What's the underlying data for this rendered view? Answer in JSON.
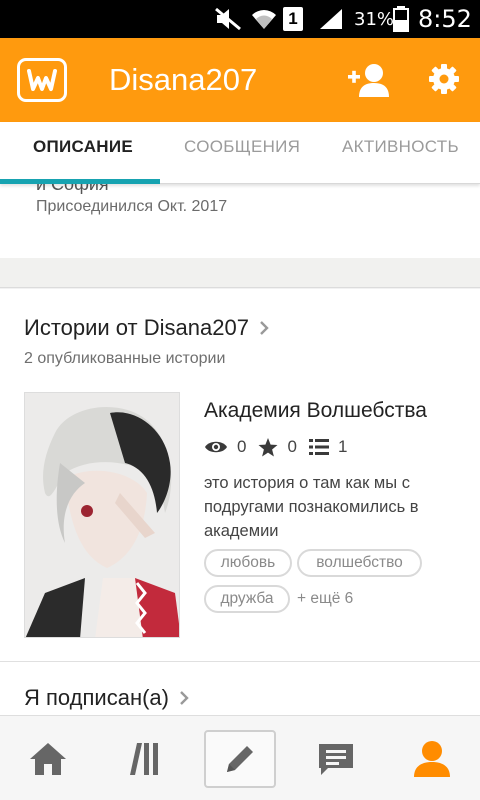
{
  "status_bar": {
    "battery_percent": "31%",
    "time": "8:52",
    "sim_slot": "1"
  },
  "app_bar": {
    "title": "Disana207",
    "logo_letter": "W"
  },
  "tabs": [
    {
      "label": "ОПИСАНИЕ",
      "active": true
    },
    {
      "label": "СООБЩЕНИЯ",
      "active": false
    },
    {
      "label": "АКТИВНОСТЬ",
      "active": false
    }
  ],
  "about": {
    "cut_text": "и София",
    "joined": "Присоединился Окт. 2017"
  },
  "stories": {
    "title": "Истории от Disana207",
    "count_text": "2 опубликованные истории",
    "items": [
      {
        "title": "Академия Волшебства",
        "views": "0",
        "votes": "0",
        "parts": "1",
        "description": "это история о там как мы с подругами познакомились в академии",
        "tags": [
          "любовь",
          "волшебство",
          "дружба"
        ],
        "more_tags": "+ ещё 6"
      }
    ]
  },
  "following": {
    "title": "Я подписан(а)"
  },
  "colors": {
    "accent_orange": "#ff9a0e",
    "tab_indicator": "#17a3b1",
    "profile_active": "#ff8c00"
  },
  "bottom_nav": [
    {
      "icon": "home-icon"
    },
    {
      "icon": "library-icon"
    },
    {
      "icon": "pencil-icon"
    },
    {
      "icon": "messages-icon"
    },
    {
      "icon": "profile-icon"
    }
  ]
}
